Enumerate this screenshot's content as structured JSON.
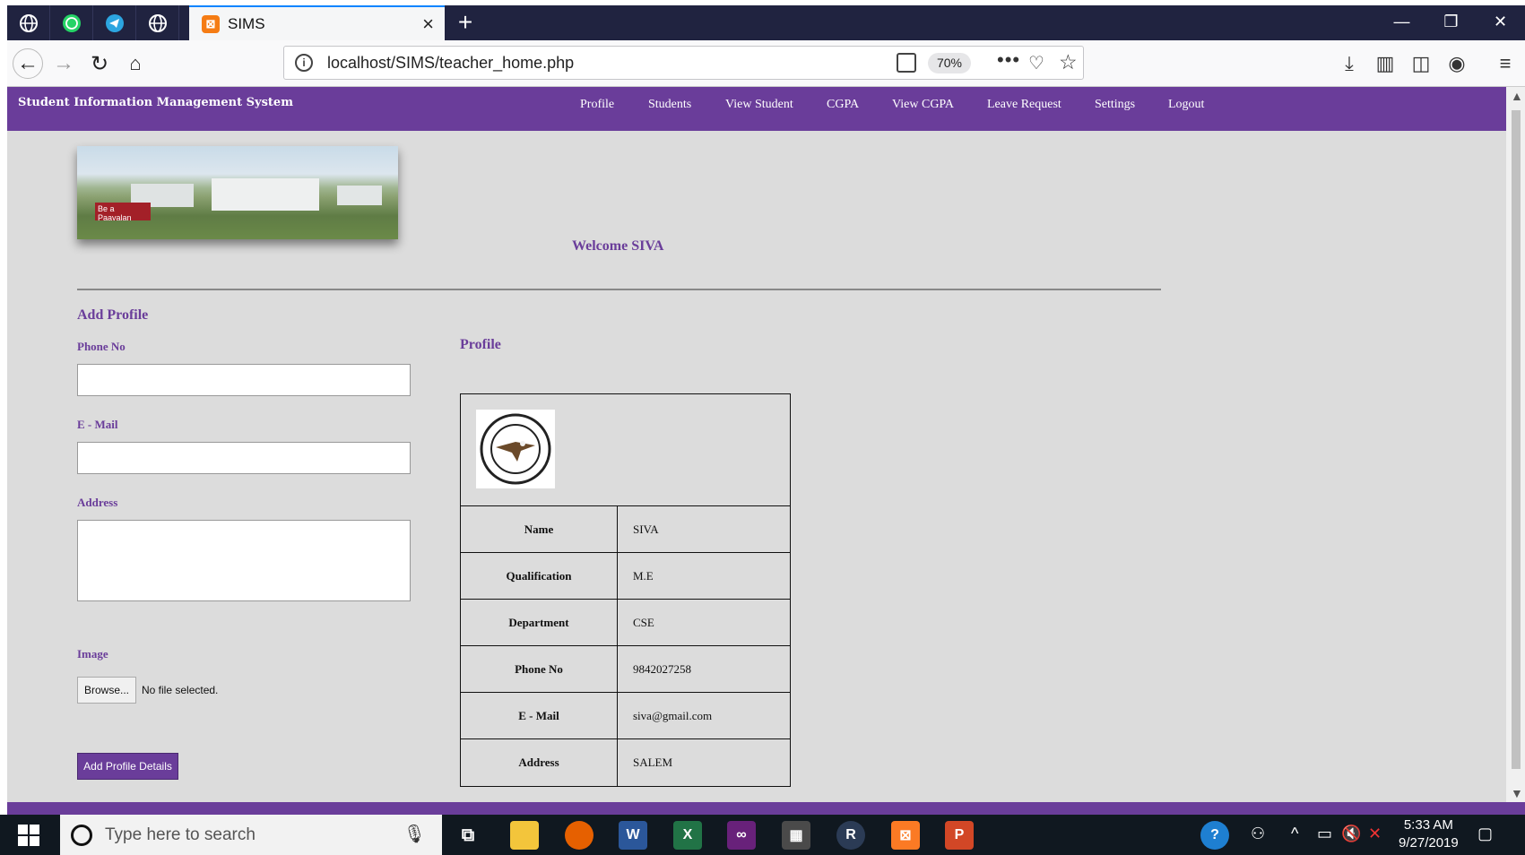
{
  "browser": {
    "tab_title": "SIMS",
    "tab_close": "×",
    "new_tab": "+",
    "url": "localhost/SIMS/teacher_home.php",
    "zoom": "70%",
    "win_min": "—",
    "win_max": "❐",
    "win_close": "✕"
  },
  "site": {
    "brand": "Student Information Management System",
    "menu": [
      "Profile",
      "Students",
      "View Student",
      "CGPA",
      "View CGPA",
      "Leave Request",
      "Settings",
      "Logout"
    ],
    "banner_tag": "Be a Paavalan",
    "welcome": "Welcome SIVA"
  },
  "add_profile": {
    "heading": "Add Profile",
    "phone_label": "Phone No",
    "email_label": "E - Mail",
    "address_label": "Address",
    "image_label": "Image",
    "browse_label": "Browse...",
    "file_status": "No file selected.",
    "submit_label": "Add Profile Details"
  },
  "profile": {
    "heading": "Profile",
    "rows": [
      {
        "key": "Name",
        "value": "SIVA"
      },
      {
        "key": "Qualification",
        "value": "M.E"
      },
      {
        "key": "Department",
        "value": "CSE"
      },
      {
        "key": "Phone No",
        "value": "9842027258"
      },
      {
        "key": "E - Mail",
        "value": "siva@gmail.com"
      },
      {
        "key": "Address",
        "value": "SALEM"
      }
    ]
  },
  "taskbar": {
    "search_placeholder": "Type here to search",
    "time": "5:33 AM",
    "date": "9/27/2019"
  },
  "colors": {
    "accent": "#6a3d9a",
    "page_bg": "#dcdcdc",
    "tabbar_bg": "#202340",
    "taskbar_bg": "#101820"
  }
}
